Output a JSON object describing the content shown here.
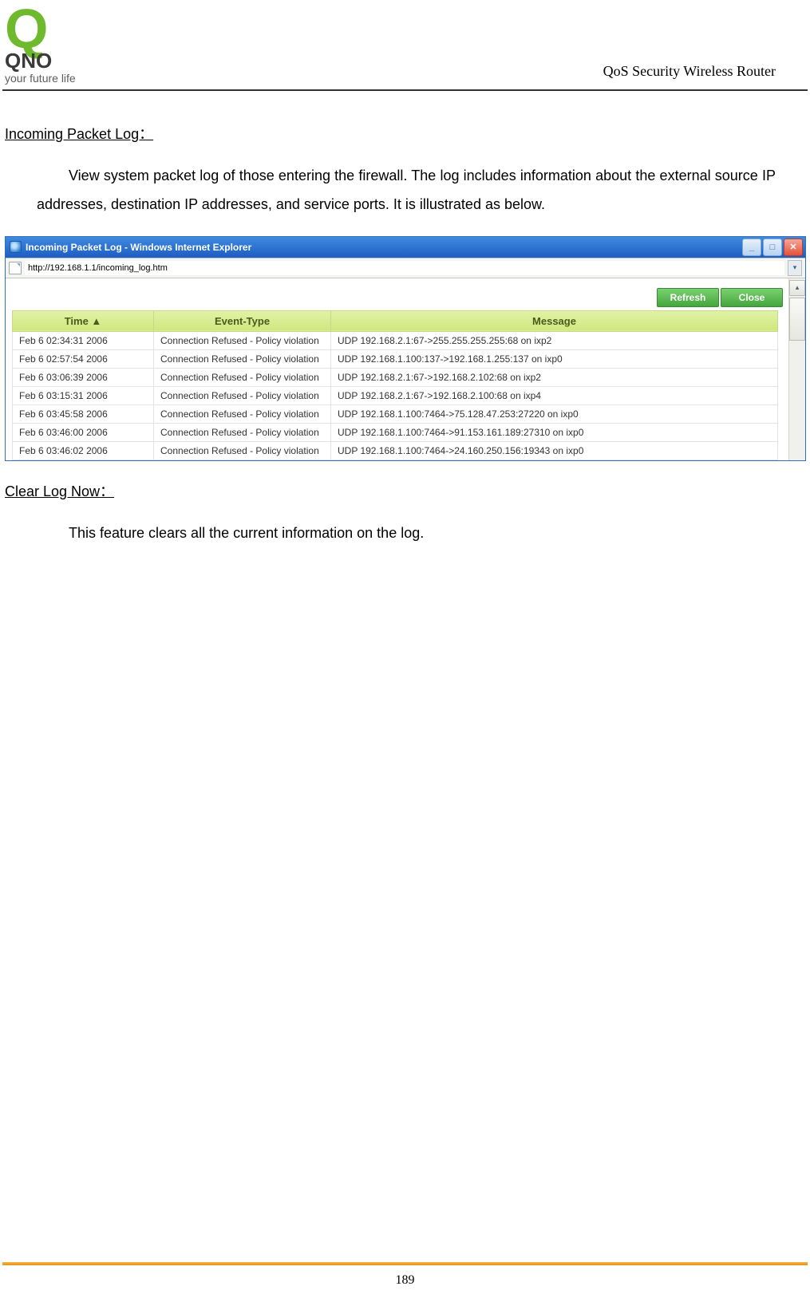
{
  "brand": {
    "logo_q": "Q",
    "name": "QNO",
    "tagline": "your future life"
  },
  "doc_title": "QoS Security Wireless Router",
  "section1": {
    "heading": "Incoming Packet Log：",
    "body": "View system packet log of those entering the firewall. The log includes information about the external source IP addresses, destination IP addresses, and service ports. It is illustrated as below."
  },
  "ie": {
    "title": "Incoming Packet Log - Windows Internet Explorer",
    "url": "http://192.168.1.1/incoming_log.htm",
    "buttons": {
      "refresh": "Refresh",
      "close": "Close"
    },
    "headers": {
      "time": "Time ▲",
      "event": "Event-Type",
      "message": "Message"
    },
    "rows": [
      {
        "time": "Feb 6 02:34:31 2006",
        "event": "Connection Refused - Policy violation",
        "msg": "UDP 192.168.2.1:67->255.255.255.255:68 on ixp2"
      },
      {
        "time": "Feb 6 02:57:54 2006",
        "event": "Connection Refused - Policy violation",
        "msg": "UDP 192.168.1.100:137->192.168.1.255:137 on ixp0"
      },
      {
        "time": "Feb 6 03:06:39 2006",
        "event": "Connection Refused - Policy violation",
        "msg": "UDP 192.168.2.1:67->192.168.2.102:68 on ixp2"
      },
      {
        "time": "Feb 6 03:15:31 2006",
        "event": "Connection Refused - Policy violation",
        "msg": "UDP 192.168.2.1:67->192.168.2.100:68 on ixp4"
      },
      {
        "time": "Feb 6 03:45:58 2006",
        "event": "Connection Refused - Policy violation",
        "msg": "UDP 192.168.1.100:7464->75.128.47.253:27220 on ixp0"
      },
      {
        "time": "Feb 6 03:46:00 2006",
        "event": "Connection Refused - Policy violation",
        "msg": "UDP 192.168.1.100:7464->91.153.161.189:27310 on ixp0"
      },
      {
        "time": "Feb 6 03:46:02 2006",
        "event": "Connection Refused - Policy violation",
        "msg": "UDP 192.168.1.100:7464->24.160.250.156:19343 on ixp0"
      }
    ]
  },
  "section2": {
    "heading": "Clear Log Now：",
    "body": "This feature clears all the current information on the log."
  },
  "page_number": "189"
}
